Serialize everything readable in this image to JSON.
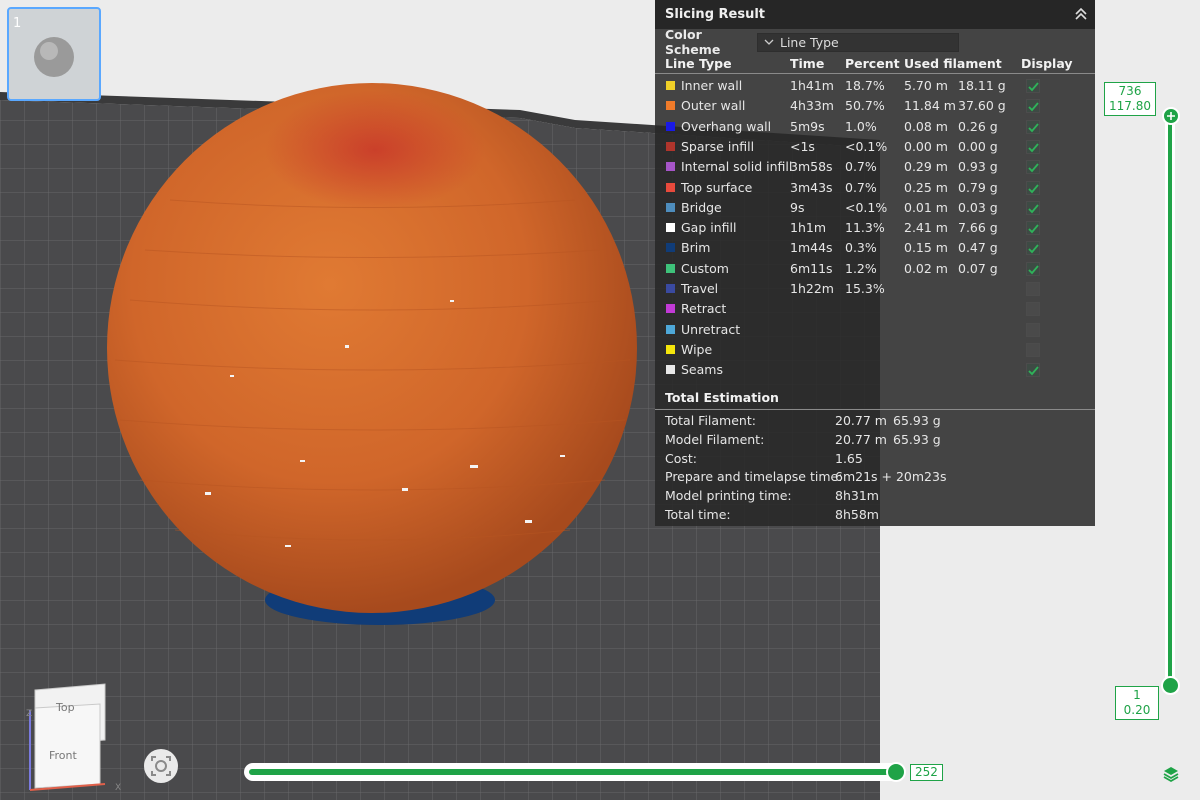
{
  "thumbnail": {
    "index": "1"
  },
  "slicing": {
    "title": "Slicing Result",
    "color_scheme_label": "Color Scheme",
    "color_scheme_value": "Line Type",
    "headers": {
      "line_type": "Line Type",
      "time": "Time",
      "percent": "Percent",
      "used_filament": "Used filament",
      "display": "Display"
    },
    "rows": [
      {
        "name": "Inner wall",
        "color": "#f0d028",
        "time": "1h41m",
        "percent": "18.7%",
        "len": "5.70 m",
        "weight": "18.11 g",
        "display": true
      },
      {
        "name": "Outer wall",
        "color": "#f07b2a",
        "time": "4h33m",
        "percent": "50.7%",
        "len": "11.84 m",
        "weight": "37.60 g",
        "display": true
      },
      {
        "name": "Overhang wall",
        "color": "#1a1ae6",
        "time": "5m9s",
        "percent": "1.0%",
        "len": "0.08 m",
        "weight": "0.26 g",
        "display": true
      },
      {
        "name": "Sparse infill",
        "color": "#b0352c",
        "time": "<1s",
        "percent": "<0.1%",
        "len": "0.00 m",
        "weight": "0.00 g",
        "display": true
      },
      {
        "name": "Internal solid infill",
        "color": "#a655c8",
        "time": "3m58s",
        "percent": "0.7%",
        "len": "0.29 m",
        "weight": "0.93 g",
        "display": true
      },
      {
        "name": "Top surface",
        "color": "#e84a3c",
        "time": "3m43s",
        "percent": "0.7%",
        "len": "0.25 m",
        "weight": "0.79 g",
        "display": true
      },
      {
        "name": "Bridge",
        "color": "#4e8dbd",
        "time": "9s",
        "percent": "<0.1%",
        "len": "0.01 m",
        "weight": "0.03 g",
        "display": true
      },
      {
        "name": "Gap infill",
        "color": "#ffffff",
        "time": "1h1m",
        "percent": "11.3%",
        "len": "2.41 m",
        "weight": "7.66 g",
        "display": true
      },
      {
        "name": "Brim",
        "color": "#103c78",
        "time": "1m44s",
        "percent": "0.3%",
        "len": "0.15 m",
        "weight": "0.47 g",
        "display": true
      },
      {
        "name": "Custom",
        "color": "#3ec27a",
        "time": "6m11s",
        "percent": "1.2%",
        "len": "0.02 m",
        "weight": "0.07 g",
        "display": true
      },
      {
        "name": "Travel",
        "color": "#3a4aa0",
        "time": "1h22m",
        "percent": "15.3%",
        "len": "",
        "weight": "",
        "display": false
      },
      {
        "name": "Retract",
        "color": "#c23ad6",
        "time": "",
        "percent": "",
        "len": "",
        "weight": "",
        "display": false
      },
      {
        "name": "Unretract",
        "color": "#4ea8d8",
        "time": "",
        "percent": "",
        "len": "",
        "weight": "",
        "display": false
      },
      {
        "name": "Wipe",
        "color": "#f5e60c",
        "time": "",
        "percent": "",
        "len": "",
        "weight": "",
        "display": false
      },
      {
        "name": "Seams",
        "color": "#e8e8e8",
        "time": "",
        "percent": "",
        "len": "",
        "weight": "",
        "display": true
      }
    ],
    "total_title": "Total Estimation",
    "totals": [
      {
        "label": "Total Filament:",
        "v1": "20.77 m",
        "v2": "65.93 g"
      },
      {
        "label": "Model Filament:",
        "v1": "20.77 m",
        "v2": "65.93 g"
      },
      {
        "label": "Cost:",
        "v1": "1.65",
        "v2": ""
      },
      {
        "label": "Prepare and timelapse time:",
        "v1": "6m21s + 20m23s",
        "v2": ""
      },
      {
        "label": "Model printing time:",
        "v1": "8h31m",
        "v2": ""
      },
      {
        "label": "Total time:",
        "v1": "8h58m",
        "v2": ""
      }
    ]
  },
  "vertical_slider": {
    "top_layer": "736",
    "top_height": "117.80",
    "bottom_layer": "1",
    "bottom_height": "0.20"
  },
  "horizontal_slider": {
    "value": "252",
    "progress": 1.0
  },
  "view_cube": {
    "top": "Top",
    "front": "Front",
    "axis_x": "X",
    "axis_z": "Z"
  },
  "colors": {
    "accent": "#1fa347",
    "model": "#d2692a",
    "brim": "#103c78",
    "bed": "#4a4a4c"
  }
}
